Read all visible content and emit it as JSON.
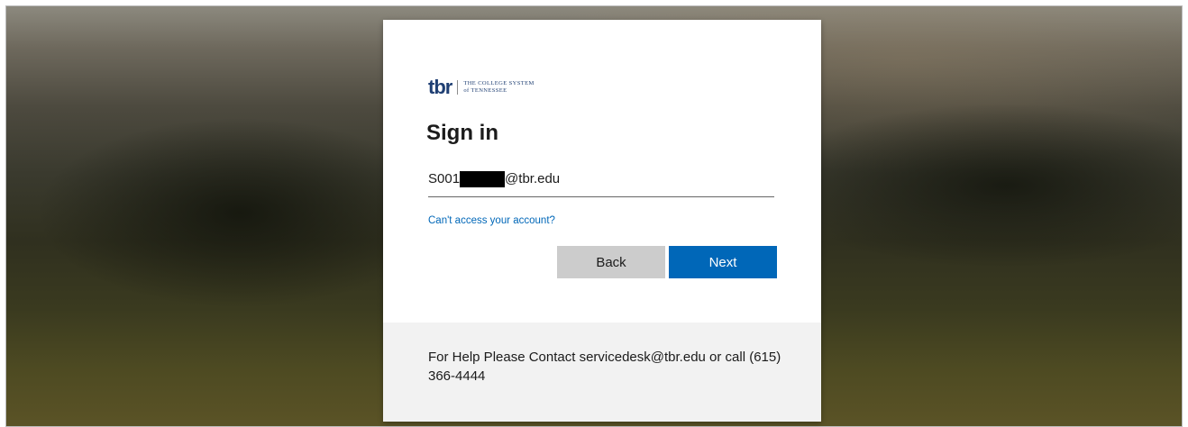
{
  "brand": {
    "logo_mark": "tbr",
    "tagline_line1": "THE COLLEGE SYSTEM",
    "tagline_line2": "of TENNESSEE",
    "colors": {
      "navy": "#1f3f73",
      "red": "#c8102e"
    }
  },
  "signin": {
    "title": "Sign in",
    "email_prefix": "S001",
    "email_suffix": "@tbr.edu",
    "cant_access_link": "Can't access your account?",
    "back_label": "Back",
    "next_label": "Next"
  },
  "footer": {
    "help_text": "For Help Please Contact servicedesk@tbr.edu or call (615) 366-4444"
  },
  "colors": {
    "primary": "#0067b8",
    "secondary_button": "#cccccc",
    "footer_bg": "#f2f2f2",
    "text": "#1b1b1b"
  }
}
